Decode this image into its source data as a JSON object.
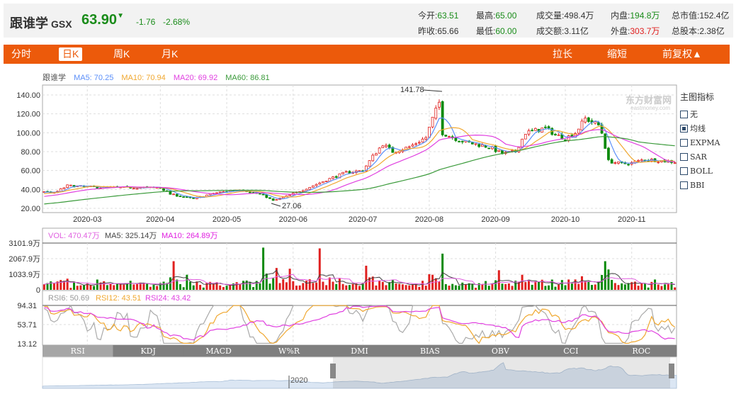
{
  "stock": {
    "name": "跟谁学",
    "code": "GSX",
    "price": "63.90",
    "arrow": "▼",
    "change": "-1.76",
    "change_pct": "-2.68%"
  },
  "stats": [
    {
      "label": "今开",
      "value": "63.51",
      "color": "g"
    },
    {
      "label": "最高",
      "value": "65.00",
      "color": "g"
    },
    {
      "label": "成交量",
      "value": "498.4万",
      "color": ""
    },
    {
      "label": "内盘",
      "value": "194.8万",
      "color": "g"
    },
    {
      "label": "总市值",
      "value": "152.4亿",
      "color": ""
    },
    {
      "label": "昨收",
      "value": "65.66",
      "color": ""
    },
    {
      "label": "最低",
      "value": "60.00",
      "color": "g"
    },
    {
      "label": "成交额",
      "value": "3.11亿",
      "color": ""
    },
    {
      "label": "外盘",
      "value": "303.7万",
      "color": "r"
    },
    {
      "label": "总股本",
      "value": "2.38亿",
      "color": ""
    }
  ],
  "toolbar": {
    "tabs": [
      "分时",
      "日K",
      "周K",
      "月K"
    ],
    "active": "日K",
    "zoom_in": "拉长",
    "zoom_out": "缩短",
    "adjust": "前复权▲"
  },
  "legend": {
    "name": "跟谁学",
    "ma5": "MA5: 70.25",
    "ma10": "MA10: 70.94",
    "ma20": "MA20: 69.92",
    "ma60": "MA60: 86.81"
  },
  "side_panel": {
    "title": "主图指标",
    "options": [
      "无",
      "均线",
      "EXPMA",
      "SAR",
      "BOLL",
      "BBI"
    ],
    "selected": "均线"
  },
  "vol_legend": {
    "vol": "VOL: 470.47万",
    "ma5": "MA5: 325.14万",
    "ma10": "MA10: 264.89万"
  },
  "rsi_legend": {
    "rsi6": "RSI6: 50.69",
    "rsi12": "RSI12: 43.51",
    "rsi24": "RSI24: 43.42"
  },
  "indicator_tabs": [
    "RSI",
    "KDJ",
    "MACD",
    "W%R",
    "DMI",
    "BIAS",
    "OBV",
    "CCI",
    "ROC"
  ],
  "navigator": {
    "year_label": "2020"
  },
  "watermark": "东方财富网 eastmoney.com",
  "colors": {
    "up": "#e0201f",
    "down": "#0a8a0a",
    "ma5": "#5b8ff9",
    "ma10": "#f0a830",
    "ma20": "#e040e0",
    "ma60": "#3a9a3a",
    "accent": "#ec5a0b"
  },
  "chart_data": {
    "type": "candlestick",
    "price_axis": {
      "ticks": [
        "140.00",
        "120.00",
        "100.00",
        "80.00",
        "60.00",
        "40.00",
        "20.00"
      ],
      "range": [
        20,
        140
      ]
    },
    "x_ticks": [
      {
        "label": "2020-03",
        "day": 13
      },
      {
        "label": "2020-04",
        "day": 35
      },
      {
        "label": "2020-05",
        "day": 55
      },
      {
        "label": "2020-06",
        "day": 75
      },
      {
        "label": "2020-07",
        "day": 96
      },
      {
        "label": "2020-08",
        "day": 116
      },
      {
        "label": "2020-09",
        "day": 136
      },
      {
        "label": "2020-10",
        "day": 157
      },
      {
        "label": "2020-11",
        "day": 177
      }
    ],
    "days": 191,
    "close_keypoints": [
      [
        -70,
        14
      ],
      [
        -30,
        22
      ],
      [
        -10,
        32
      ],
      [
        0,
        38
      ],
      [
        3,
        36
      ],
      [
        7,
        44
      ],
      [
        17,
        42
      ],
      [
        35,
        42
      ],
      [
        38,
        35
      ],
      [
        45,
        30
      ],
      [
        51,
        36
      ],
      [
        59,
        40
      ],
      [
        66,
        34
      ],
      [
        69,
        28
      ],
      [
        74,
        34
      ],
      [
        81,
        44
      ],
      [
        85,
        50
      ],
      [
        91,
        58
      ],
      [
        96,
        60
      ],
      [
        99,
        75
      ],
      [
        102,
        88
      ],
      [
        105,
        80
      ],
      [
        110,
        85
      ],
      [
        115,
        95
      ],
      [
        117,
        115
      ],
      [
        119,
        132
      ],
      [
        120,
        100
      ],
      [
        123,
        95
      ],
      [
        127,
        90
      ],
      [
        134,
        85
      ],
      [
        138,
        78
      ],
      [
        142,
        80
      ],
      [
        145,
        100
      ],
      [
        151,
        105
      ],
      [
        154,
        98
      ],
      [
        157,
        94
      ],
      [
        160,
        100
      ],
      [
        163,
        115
      ],
      [
        167,
        108
      ],
      [
        168,
        100
      ],
      [
        170,
        70
      ],
      [
        174,
        67
      ],
      [
        177,
        68
      ],
      [
        181,
        72
      ],
      [
        187,
        70
      ],
      [
        190,
        69
      ]
    ],
    "annotations": {
      "high": "141.78",
      "low": "27.06"
    },
    "volume_axis": {
      "ticks": [
        "3101.9万",
        "2067.9万",
        "1033.9万",
        "0"
      ],
      "max": 3101.9
    },
    "volume_spikes": [
      [
        39,
        1900
      ],
      [
        43,
        1000
      ],
      [
        66,
        2800
      ],
      [
        70,
        1450
      ],
      [
        83,
        2750
      ],
      [
        97,
        1600
      ],
      [
        120,
        2400
      ],
      [
        137,
        1300
      ],
      [
        144,
        1000
      ],
      [
        169,
        1900
      ],
      [
        74,
        1400
      ],
      [
        117,
        1000
      ]
    ],
    "rsi_axis": {
      "ticks": [
        "94.31",
        "53.71",
        "13.12"
      ],
      "range": [
        13.12,
        94.31
      ]
    }
  }
}
